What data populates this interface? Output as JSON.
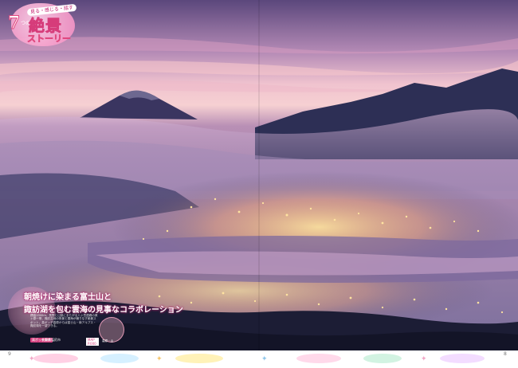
{
  "badge": {
    "kicker": "見る・感じる・話す",
    "number": "7",
    "small": "つの",
    "title": "絶景",
    "subtitle": "ストーリー"
  },
  "caption": {
    "line1": "朝焼けに染まる富士山と",
    "line2": "諏訪湖を包む雲海の見事なコラボレーション"
  },
  "info": {
    "body": "標高1900m、長野と山梨にまたがる八ヶ岳連峰の美ヶ原一帯、諏訪盆地の夜景と雲海が織りなす絶景スポット。高ボッチ高原からは富士山・南アルプス・諏訪湖を一望できる。",
    "tag": "高ボッチ高原",
    "name": "長野県塩尻市",
    "map": "MAP P.000"
  },
  "stamp_label": "高原・山",
  "page_numbers": {
    "left": "9",
    "right": "8"
  },
  "colors": {
    "accent": "#e0487f",
    "sky_top": "#6a4d8a",
    "sky_glow": "#f3c6cf",
    "city_lights": "#ffd27a"
  }
}
